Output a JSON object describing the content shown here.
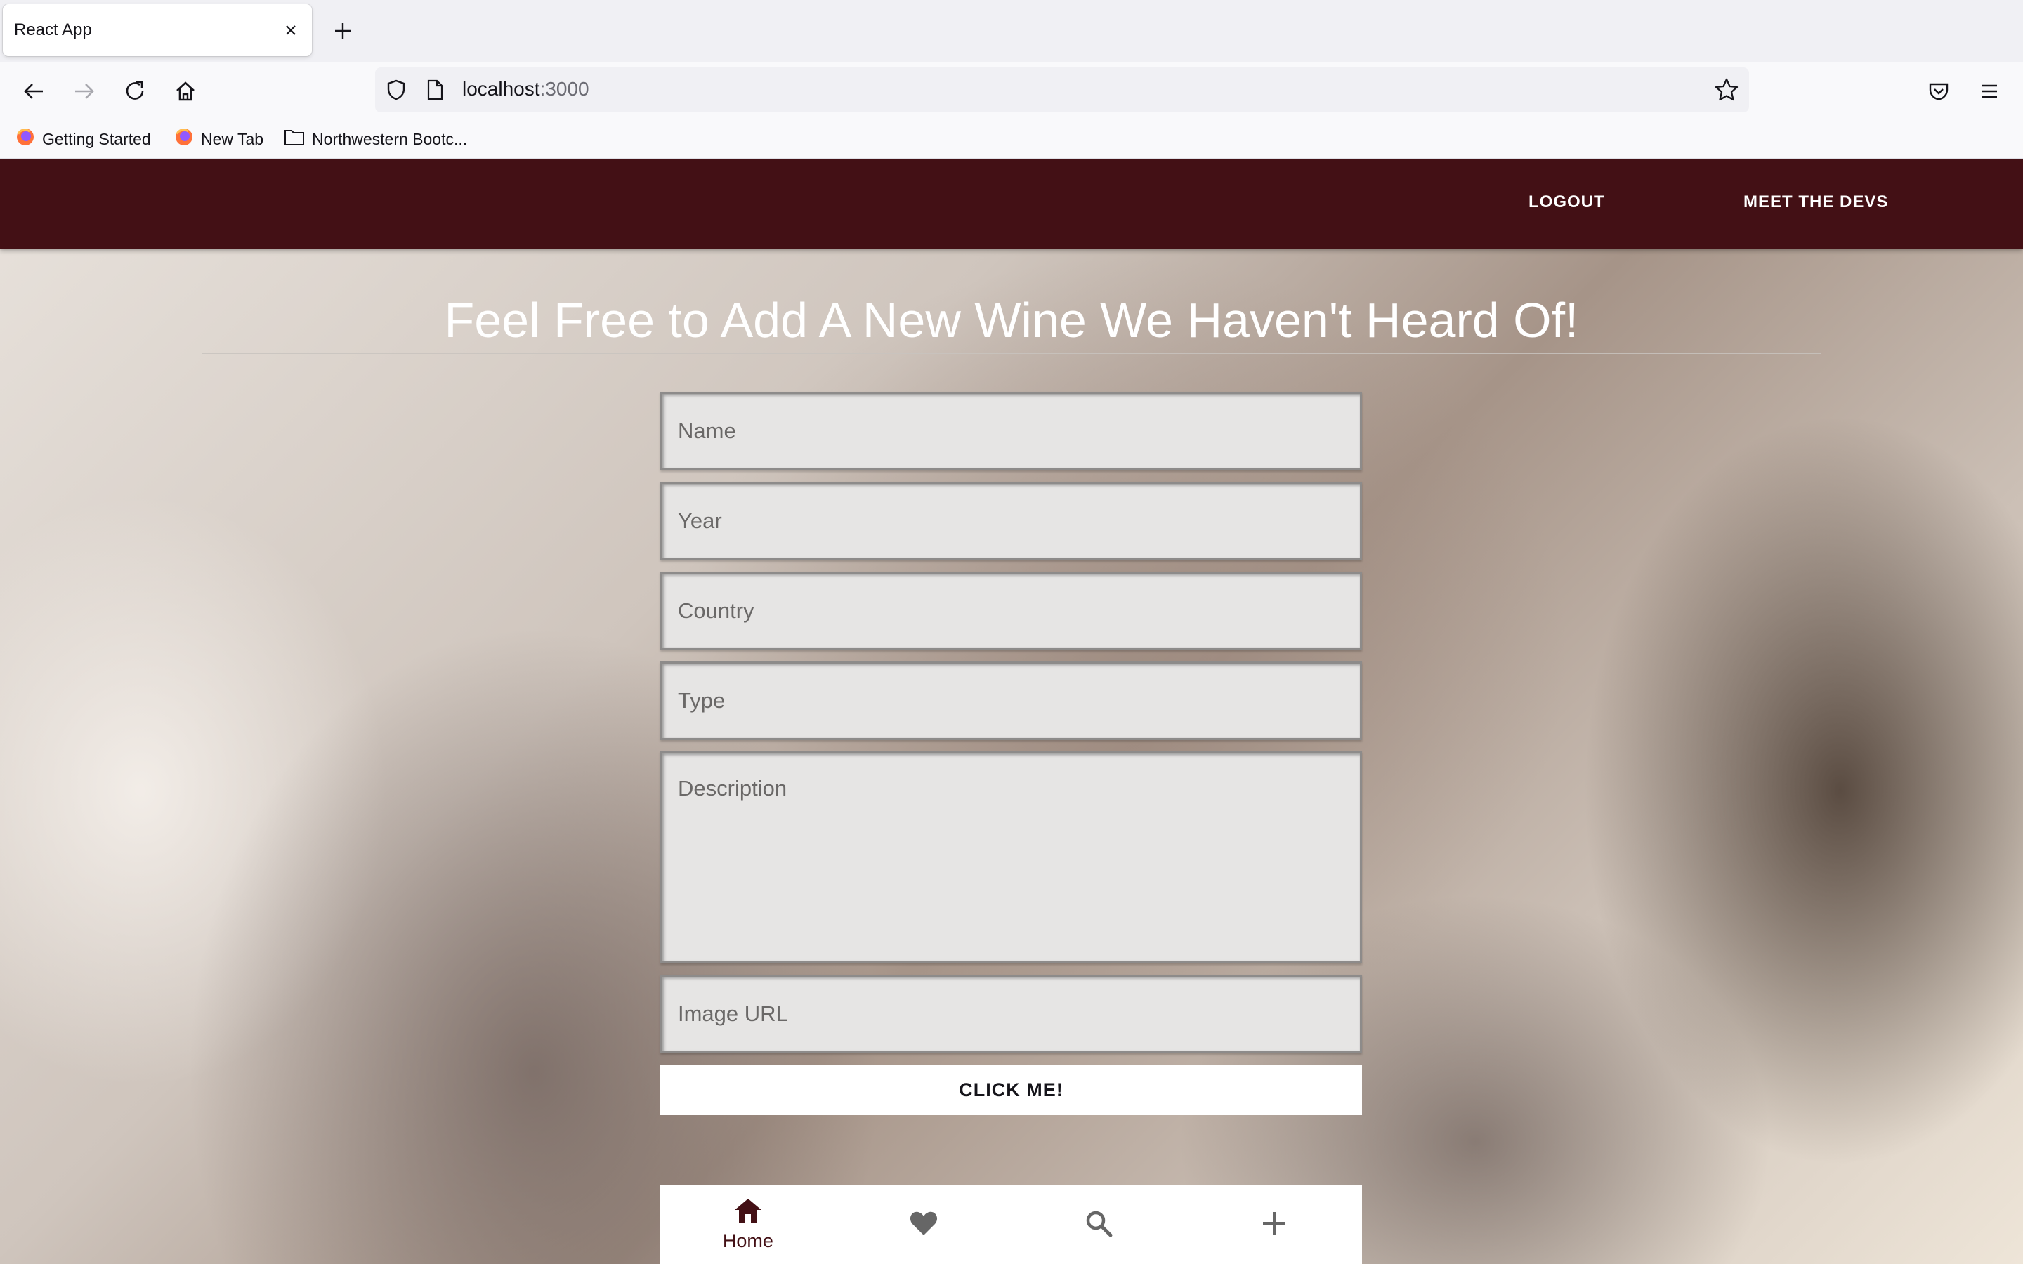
{
  "browser": {
    "tab_title": "React App",
    "url_host": "localhost",
    "url_port": ":3000",
    "bookmarks": [
      {
        "label": "Getting Started",
        "icon": "firefox-icon"
      },
      {
        "label": "New Tab",
        "icon": "firefox-icon"
      },
      {
        "label": "Northwestern Bootc...",
        "icon": "folder-icon"
      }
    ]
  },
  "appbar": {
    "logout_label": "LOGOUT",
    "devs_label": "MEET THE DEVS",
    "color": "#431015"
  },
  "form": {
    "heading": "Feel Free to Add A New Wine We Haven't Heard Of!",
    "name_placeholder": "Name",
    "year_placeholder": "Year",
    "country_placeholder": "Country",
    "type_placeholder": "Type",
    "description_placeholder": "Description",
    "image_placeholder": "Image URL",
    "submit_label": "CLICK ME!"
  },
  "bottom_nav": {
    "items": [
      {
        "label": "Home",
        "icon": "home-icon",
        "active": true
      },
      {
        "label": "",
        "icon": "heart-icon"
      },
      {
        "label": "",
        "icon": "search-icon"
      },
      {
        "label": "",
        "icon": "plus-icon"
      }
    ],
    "active_color": "#431015",
    "inactive_color": "#666666"
  }
}
